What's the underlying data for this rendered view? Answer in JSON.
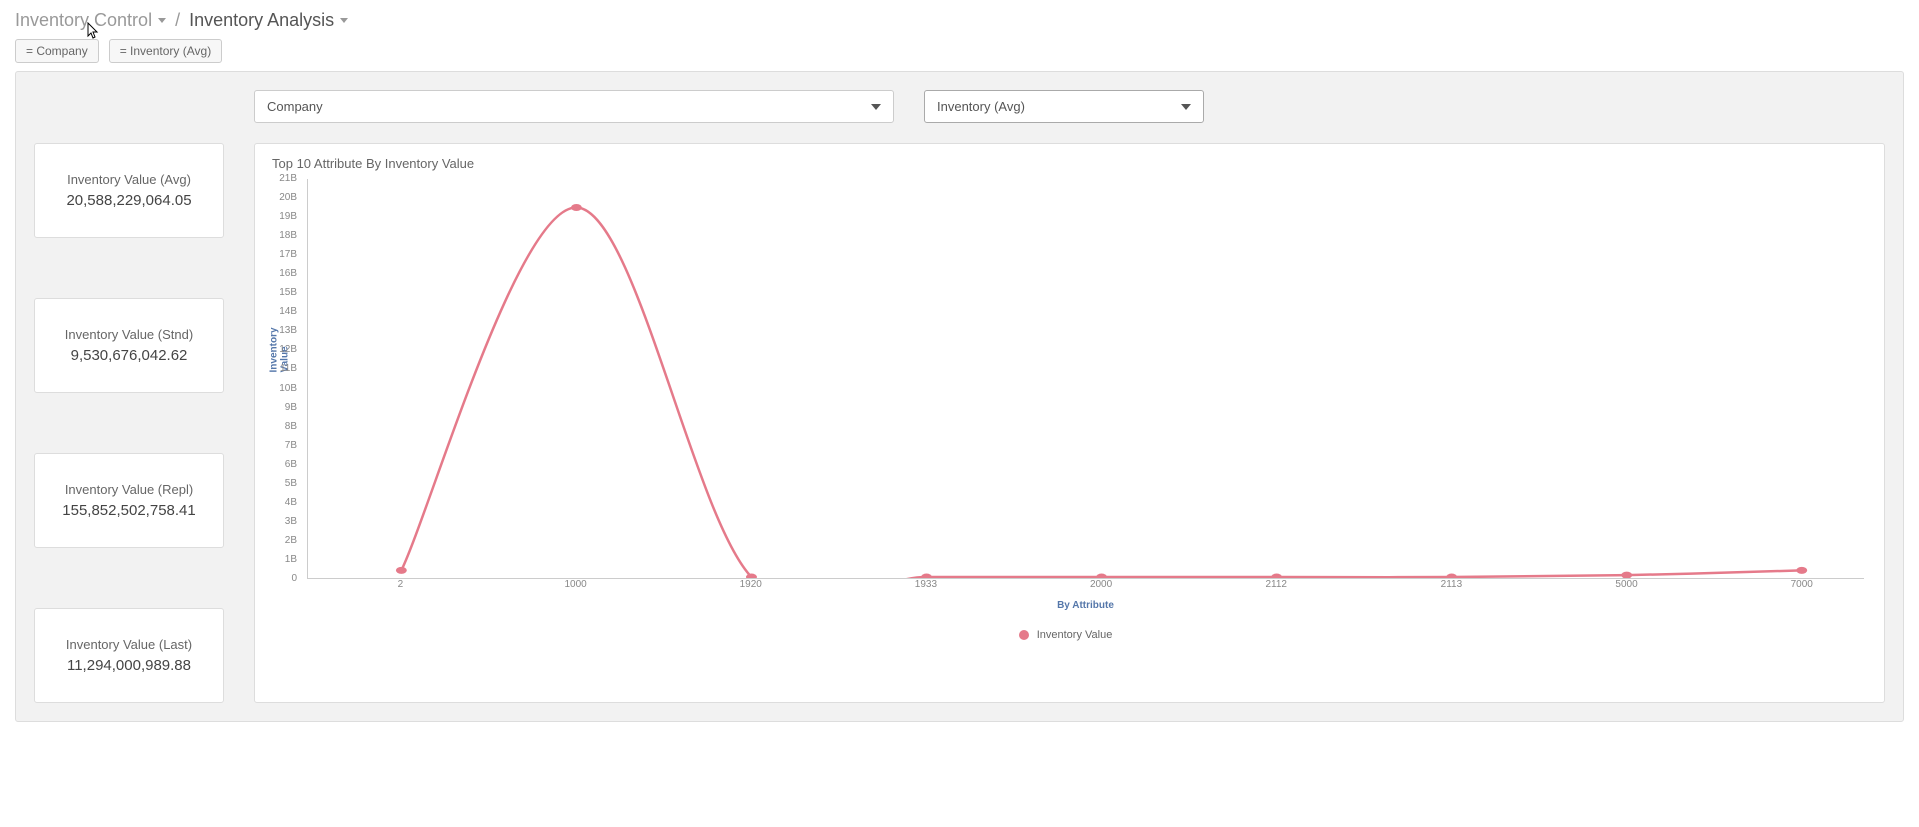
{
  "breadcrumb": {
    "parent": "Inventory Control",
    "current": "Inventory Analysis",
    "sep": "/"
  },
  "chips": {
    "company": "= Company",
    "inventory_avg": "= Inventory (Avg)"
  },
  "selectors": {
    "company": "Company",
    "metric": "Inventory (Avg)"
  },
  "kpis": [
    {
      "label": "Inventory Value (Avg)",
      "value": "20,588,229,064.05"
    },
    {
      "label": "Inventory Value (Stnd)",
      "value": "9,530,676,042.62"
    },
    {
      "label": "Inventory Value (Repl)",
      "value": "155,852,502,758.41"
    },
    {
      "label": "Inventory Value (Last)",
      "value": "11,294,000,989.88"
    }
  ],
  "chart_data": {
    "type": "line",
    "title": "Top 10 Attribute By Inventory Value",
    "xlabel": "By Attribute",
    "ylabel": "Inventory Value",
    "x": [
      "2",
      "1000",
      "1920",
      "1933",
      "2000",
      "2112",
      "2113",
      "5000",
      "7000"
    ],
    "series": [
      {
        "name": "Inventory Value",
        "values": [
          400000000,
          19500000000,
          50000000,
          50000000,
          50000000,
          50000000,
          50000000,
          150000000,
          400000000
        ]
      }
    ],
    "ylim": [
      0,
      21000000000
    ],
    "y_ticks": [
      "0",
      "1B",
      "2B",
      "3B",
      "4B",
      "5B",
      "6B",
      "7B",
      "8B",
      "9B",
      "10B",
      "11B",
      "12B",
      "13B",
      "14B",
      "15B",
      "16B",
      "17B",
      "18B",
      "19B",
      "20B",
      "21B"
    ],
    "color": "#e57a8a",
    "legend_label": "Inventory Value"
  }
}
